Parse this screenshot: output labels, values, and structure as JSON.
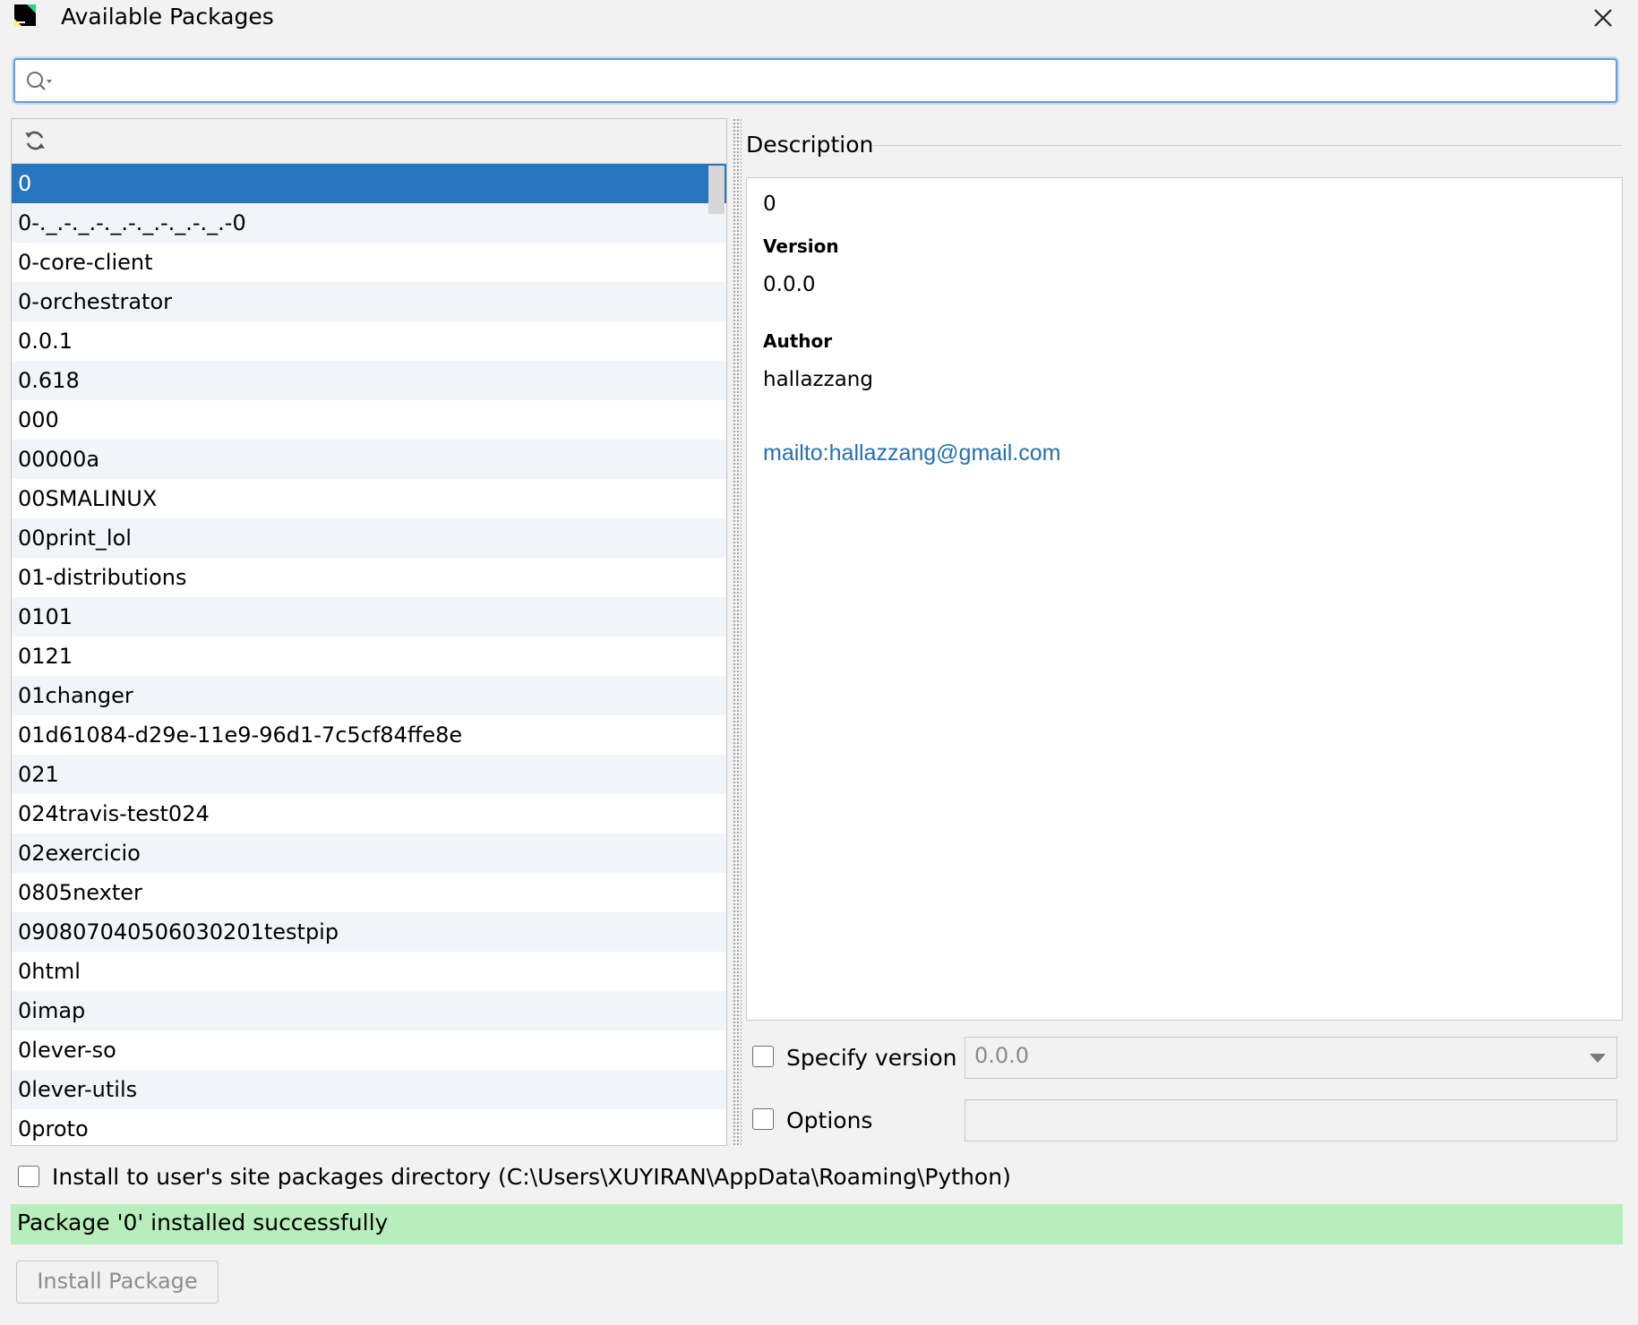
{
  "window": {
    "title": "Available Packages",
    "app_icon": "pycharm-logo",
    "close_icon": "close-icon"
  },
  "search": {
    "value": "",
    "placeholder": "",
    "icon": "search-icon"
  },
  "package_list": {
    "reload_icon": "reload-icon",
    "selected": "0",
    "items": [
      "0",
      "0-._.-._.-._.-._.-._.-._.-0",
      "0-core-client",
      "0-orchestrator",
      "0.0.1",
      "0.618",
      "000",
      "00000a",
      "00SMALINUX",
      "00print_lol",
      "01-distributions",
      "0101",
      "0121",
      "01changer",
      "01d61084-d29e-11e9-96d1-7c5cf84ffe8e",
      "021",
      "024travis-test024",
      "02exercicio",
      "0805nexter",
      "090807040506030201testpip",
      "0html",
      "0imap",
      "0lever-so",
      "0lever-utils",
      "0proto"
    ]
  },
  "description": {
    "heading": "Description",
    "name": "0",
    "version_label": "Version",
    "version_value": "0.0.0",
    "author_label": "Author",
    "author_value": "hallazzang",
    "link": "mailto:hallazzang@gmail.com",
    "link_color": "#2470b3"
  },
  "specify_version": {
    "label": "Specify version",
    "checked": false,
    "selected_value": "0.0.0"
  },
  "options": {
    "label": "Options",
    "checked": false,
    "value": ""
  },
  "install_user": {
    "label": "Install to user's site packages directory (C:\\Users\\XUYIRAN\\AppData\\Roaming\\Python)",
    "checked": false
  },
  "status": {
    "message": "Package '0' installed successfully",
    "color": "#b8eebb"
  },
  "actions": {
    "install_label": "Install Package"
  },
  "theme": {
    "selection": "#2675bf",
    "focus": "#6b9ad6"
  }
}
